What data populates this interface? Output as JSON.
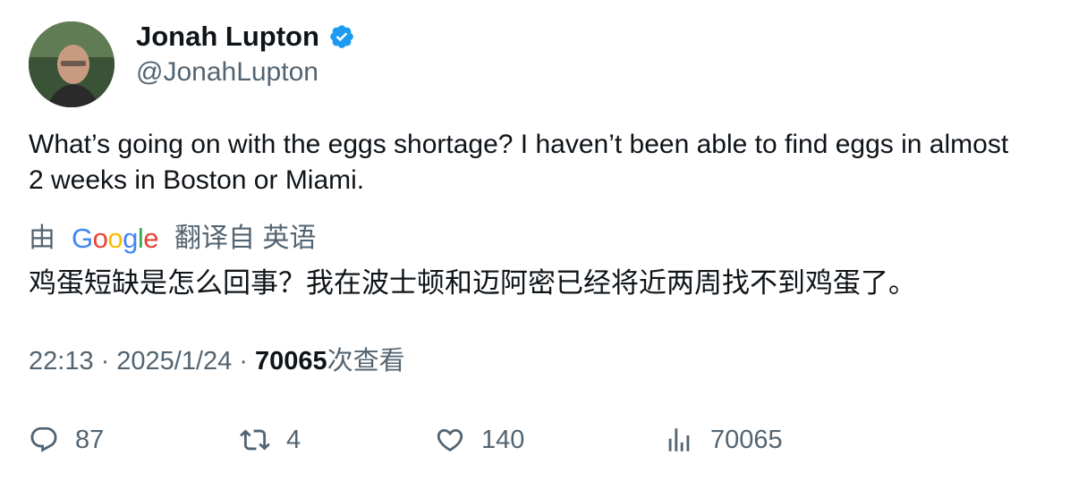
{
  "user": {
    "display_name": "Jonah Lupton",
    "handle": "@JonahLupton",
    "verified": true,
    "verified_color": "#1d9bf0"
  },
  "tweet": {
    "text": "What’s going on with the eggs shortage? I haven’t been able to find eggs in almost 2 weeks in Boston or Miami."
  },
  "translation": {
    "prefix": "由",
    "provider": "Google",
    "suffix": "翻译自 英语",
    "text": "鸡蛋短缺是怎么回事？我在波士顿和迈阿密已经将近两周找不到鸡蛋了。"
  },
  "meta": {
    "time": "22:13",
    "separator": "·",
    "date": "2025/1/24",
    "views_count": "70065",
    "views_label": "次查看"
  },
  "actions": {
    "replies": "87",
    "retweets": "4",
    "likes": "140",
    "views": "70065"
  },
  "icons": {
    "reply": "reply-icon",
    "retweet": "retweet-icon",
    "like": "heart-icon",
    "views": "views-bar-chart-icon",
    "verified": "verified-badge-icon"
  },
  "colors": {
    "text": "#0f1419",
    "secondary": "#536471"
  }
}
